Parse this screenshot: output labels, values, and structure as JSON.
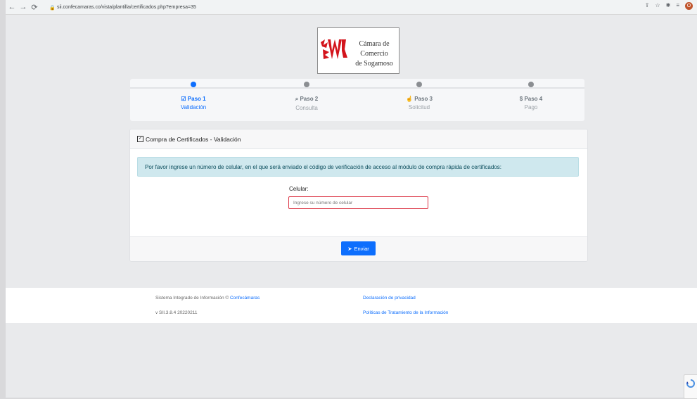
{
  "browser": {
    "url": "sii.confecamaras.co/vista/plantilla/certificados.php?empresa=35",
    "profile_initial": "O"
  },
  "logo": {
    "line1": "Cámara de Comercio",
    "line2": "de Sogamoso"
  },
  "steps": [
    {
      "title": "Paso 1",
      "sub": "Validación",
      "icon": "checkbox-icon",
      "active": true
    },
    {
      "title": "Paso 2",
      "sub": "Consulta",
      "icon": "search-icon",
      "active": false
    },
    {
      "title": "Paso 3",
      "sub": "Solicitud",
      "icon": "hand-pointer-icon",
      "active": false
    },
    {
      "title": "Paso 4",
      "sub": "Pago",
      "icon": "dollar-icon",
      "active": false
    }
  ],
  "card": {
    "header": "Compra de Certificados - Validación",
    "alert": "Por favor ingrese un número de celular, en el que será enviado el código de verificación de acceso al módulo de compra rápida de certificados:",
    "field_label": "Celular:",
    "field_placeholder": "Ingrese su número de celular",
    "send_label": "Enviar"
  },
  "footer": {
    "system_text": "Sistema Integrado de Información ©",
    "system_link": "Confecámaras",
    "version": "v SII.3.8.4 20220211",
    "privacy_link": "Declaración de privacidad",
    "policy_link": "Políticas de Tratamiento de la Información"
  },
  "colors": {
    "accent": "#0d6efd",
    "alert_bg": "#cfe8ee",
    "error_border": "#dc3545"
  }
}
